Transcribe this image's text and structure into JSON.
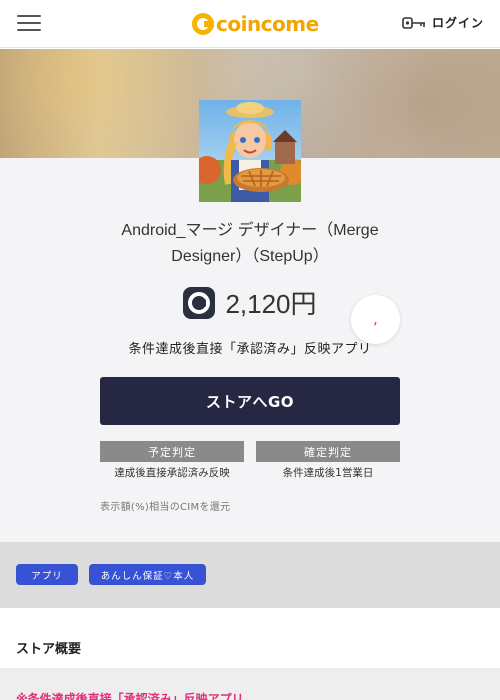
{
  "header": {
    "logo_text": "coincome",
    "login_label": "ログイン"
  },
  "app": {
    "title_line1": "Android_マージ デザイナー（Merge",
    "title_line2": "Designer）（StepUp）",
    "points": "2,120円",
    "condition": "条件達成後直接「承認済み」反映アプリ",
    "go_button": "ストアへGO"
  },
  "judgement": {
    "scheduled_label": "予定判定",
    "scheduled_desc": "達成後直接承認済み反映",
    "confirmed_label": "確定判定",
    "confirmed_desc": "条件達成後1営業日"
  },
  "note": "表示額(%)相当のCIMを還元",
  "tags": [
    "アプリ",
    "あんしん保証♡本人"
  ],
  "section": {
    "title": "ストア概要",
    "first_line": "※条件達成後直接「承認済み」反映アプリ"
  },
  "icons": {
    "menu": "hamburger-icon",
    "key": "key-icon",
    "favorite": "heart-icon",
    "points": "cim-icon"
  },
  "colors": {
    "brand": "#f3a600",
    "go_button": "#262743",
    "tag": "#3852d6",
    "accent_text": "#e0307a"
  }
}
